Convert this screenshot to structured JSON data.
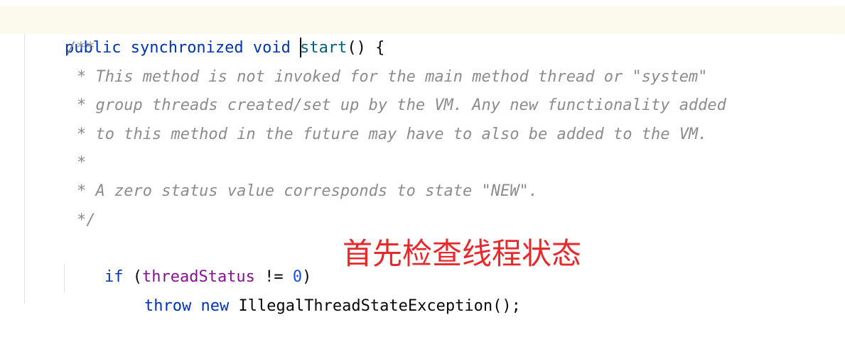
{
  "code": {
    "line1": {
      "kw_public": "public",
      "kw_synchronized": "synchronized",
      "kw_void": "void",
      "method_name": "start",
      "rest": "() {"
    },
    "doc": {
      "open": "/**",
      "l1": "* This method is not invoked for the main method thread or \"system\"",
      "l2": "* group threads created/set up by the VM. Any new functionality added",
      "l3": "* to this method in the future may have to also be added to the VM.",
      "l4": "*",
      "l5": "* A zero status value corresponds to state \"NEW\".",
      "close": "*/"
    },
    "if_line": {
      "kw_if": "if",
      "open": "(",
      "field": "threadStatus",
      "op": " != ",
      "number": "0",
      "close": ")"
    },
    "throw_line": {
      "kw_throw": "throw",
      "kw_new": "new",
      "rest": "IllegalThreadStateException();"
    }
  },
  "annotation": {
    "text": "首先检查线程状态",
    "color": "#e8282b"
  },
  "colors": {
    "keyword": "#0033b3",
    "method": "#00627a",
    "field": "#871094",
    "number": "#1750eb",
    "doc_comment": "#8c8c8c",
    "current_line": "#fcfaed"
  }
}
